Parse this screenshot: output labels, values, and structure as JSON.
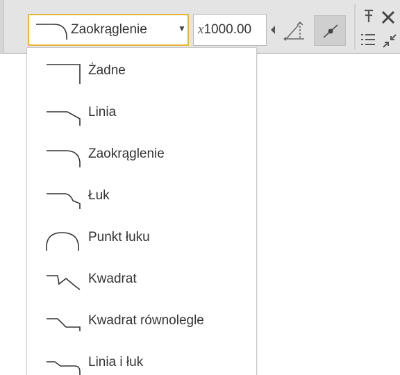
{
  "toolbar": {
    "selected_style": {
      "label": "Zaokrąglenie",
      "icon": "rounded-corner-icon",
      "arrow": "▼"
    },
    "scale": {
      "prefix": "x",
      "value": "1000.00"
    },
    "accent_color": "#e6b73a"
  },
  "dropdown": {
    "items": [
      {
        "label": "Żadne",
        "icon": "corner-none-icon"
      },
      {
        "label": "Linia",
        "icon": "corner-line-icon"
      },
      {
        "label": "Zaokrąglenie",
        "icon": "corner-round-icon"
      },
      {
        "label": "Łuk",
        "icon": "corner-arc-icon"
      },
      {
        "label": "Punkt łuku",
        "icon": "arc-point-icon"
      },
      {
        "label": "Kwadrat",
        "icon": "corner-square-icon"
      },
      {
        "label": "Kwadrat równolegle",
        "icon": "corner-square-parallel-icon"
      },
      {
        "label": "Linia i łuk",
        "icon": "corner-line-arc-icon"
      }
    ]
  }
}
